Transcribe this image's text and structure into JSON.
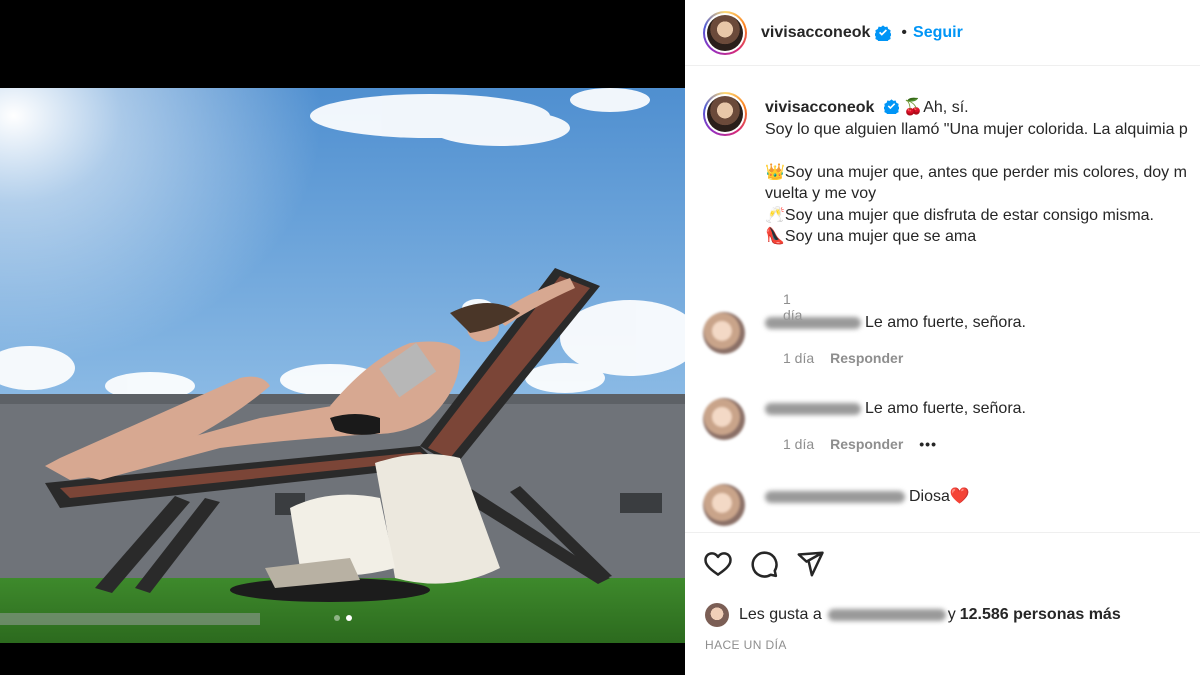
{
  "post": {
    "username": "vivisacconeok",
    "follow_label": "Seguir",
    "separator": "•",
    "caption": {
      "line1": "Ah, sí.",
      "line1_emoji": "🍒",
      "line2": "Soy lo que alguien llamó \"Una mujer colorida. La alquimia p",
      "line3_emoji": "👑",
      "line3": "Soy una mujer que, antes que perder mis colores, doy m",
      "line4": "vuelta y me voy",
      "line5_emoji": "🥂",
      "line5": "Soy una mujer que disfruta de estar consigo misma.",
      "line6_emoji": "👠",
      "line6": "Soy una mujer que se ama",
      "age": "1 día"
    },
    "comments": [
      {
        "text": "Le amo fuerte, señora.",
        "age": "1 día",
        "reply": "Responder",
        "more": ""
      },
      {
        "text": "Le amo fuerte, señora.",
        "age": "1 día",
        "reply": "Responder",
        "more": "•••"
      },
      {
        "text": "Diosa",
        "emoji": "❤️"
      }
    ],
    "likes": {
      "prefix": "Les gusta a",
      "suffix": "y",
      "count_text": "12.586 personas más"
    },
    "timestamp": "HACE UN DÍA"
  },
  "carousel": {
    "count": 2,
    "active_index": 1
  },
  "colors": {
    "accent": "#0095f6",
    "text": "#262626",
    "muted": "#8e8e8e",
    "heart": "#ed4956"
  }
}
